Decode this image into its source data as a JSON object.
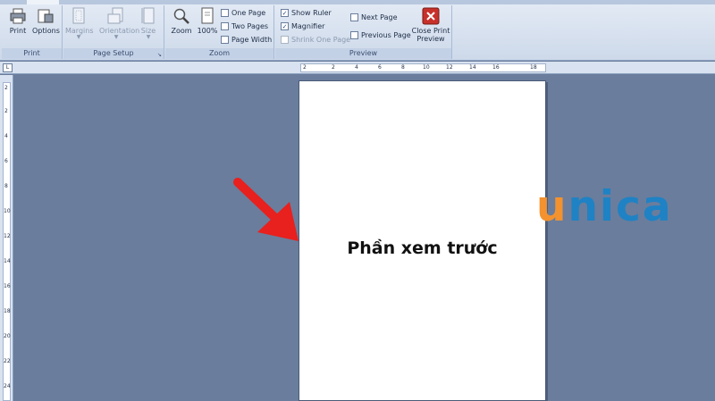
{
  "ribbon": {
    "print_group": {
      "label": "Print",
      "print": "Print",
      "options": "Options"
    },
    "page_setup_group": {
      "label": "Page Setup",
      "margins": "Margins",
      "orientation": "Orientation",
      "size": "Size"
    },
    "zoom_group": {
      "label": "Zoom",
      "zoom": "Zoom",
      "percent": "100%",
      "one_page": "One Page",
      "two_pages": "Two Pages",
      "page_width": "Page Width"
    },
    "preview_group": {
      "label": "Preview",
      "show_ruler": "Show Ruler",
      "magnifier": "Magnifier",
      "shrink_one_page": "Shrink One Page",
      "next_page": "Next Page",
      "previous_page": "Previous Page",
      "close_line1": "Close Print",
      "close_line2": "Preview"
    }
  },
  "ruler": {
    "corner": "L",
    "h_ticks": [
      "2",
      "2",
      "4",
      "6",
      "8",
      "10",
      "12",
      "14",
      "16",
      "18"
    ],
    "v_ticks": [
      "2",
      "2",
      "4",
      "6",
      "8",
      "10",
      "12",
      "14",
      "16",
      "18",
      "20",
      "22",
      "24"
    ]
  },
  "page": {
    "text": "Phần xem trước"
  },
  "logo": {
    "u": "u",
    "rest": "nica"
  },
  "colors": {
    "canvas": "#6a7d9c",
    "arrow": "#e8201e",
    "logo_orange": "#f3922f",
    "logo_blue": "#1f82c4",
    "close_button": "#c8302a"
  }
}
